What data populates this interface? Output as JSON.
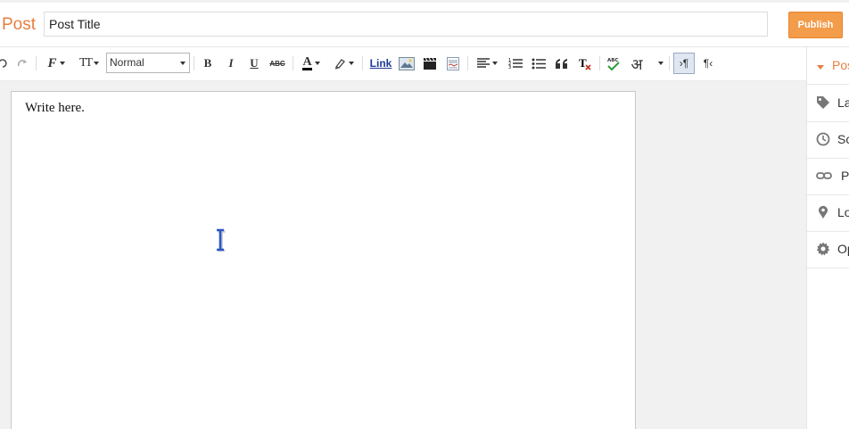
{
  "header": {
    "post_label": "Post",
    "title_value": "Post Title",
    "publish_label": "Publish"
  },
  "toolbar": {
    "format_value": "Normal",
    "link_label": "Link",
    "bold": "B",
    "italic": "I",
    "underline": "U",
    "strikethrough": "ABC",
    "font_size_glyph": "TT",
    "font_glyph": "F",
    "text_color_glyph": "A",
    "transliterate_glyph": "अ",
    "rtl_glyph": "¶",
    "ltr_glyph": "¶",
    "spellcheck_glyph": "ABC"
  },
  "editor": {
    "content": "Write here."
  },
  "sidebar": {
    "items": [
      {
        "label": "Post settings",
        "icon": "caret-down-icon"
      },
      {
        "label": "Labels",
        "icon": "tag-icon"
      },
      {
        "label": "Schedule",
        "icon": "clock-icon"
      },
      {
        "label": "Permalink",
        "icon": "link-icon"
      },
      {
        "label": "Location",
        "icon": "map-pin-icon"
      },
      {
        "label": "Options",
        "icon": "gear-icon"
      }
    ]
  },
  "colors": {
    "accent": "#e67e3f",
    "publish_bg": "#f39c4a"
  }
}
